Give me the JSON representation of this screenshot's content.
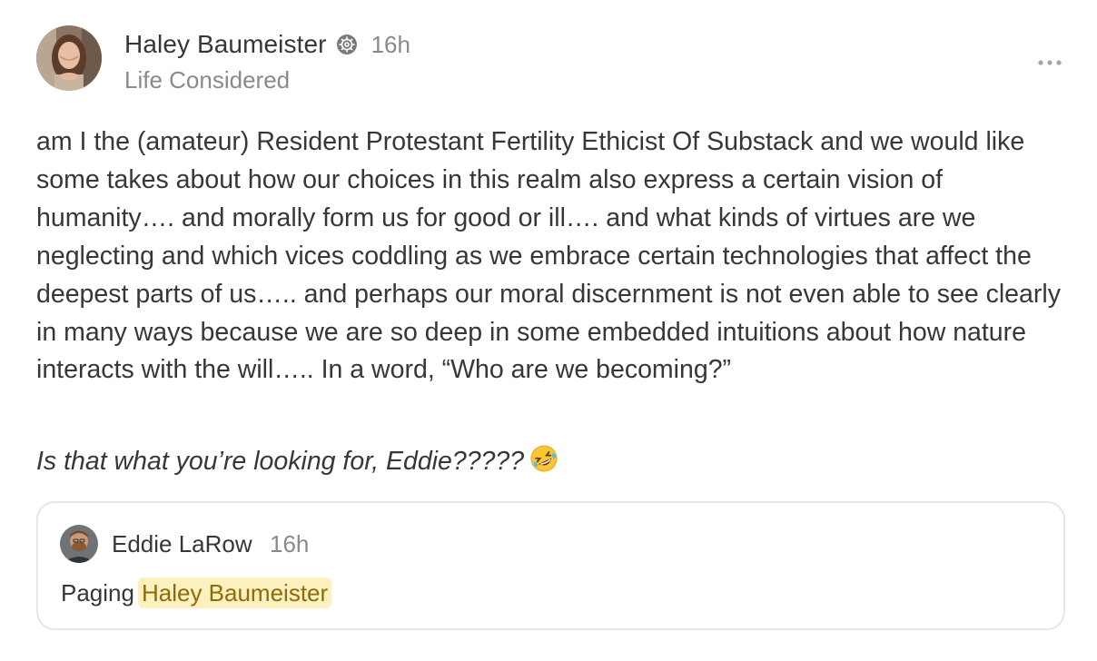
{
  "post": {
    "author": {
      "name": "Haley Baumeister",
      "publication": "Life Considered",
      "timestamp": "16h",
      "badge_icon": "substack-badge-icon"
    },
    "more_icon": "ellipsis-icon",
    "body": "am I the (amateur) Resident Protestant Fertility Ethicist Of Substack and we would like some takes about how our choices in this realm also express a certain vision of humanity…. and morally form us for good or ill…. and what kinds of virtues are we neglecting and which vices coddling as we embrace certain technologies that affect the deepest parts of us….. and perhaps our moral discernment is not even able to see clearly in many ways because we are so deep in some embedded intuitions about how nature interacts with the will….. In a word, “Who are we becoming?”",
    "italic_line": "Is that what you’re looking for, Eddie?????",
    "emoji": "🤣",
    "quoted": {
      "author": "Eddie LaRow",
      "timestamp": "16h",
      "text_prefix": "Paging",
      "mention": "Haley Baumeister"
    }
  },
  "colors": {
    "text": "#363737",
    "muted": "#8a8a8a",
    "mention_bg": "#fdf0bf",
    "mention_text": "#8a6d0a",
    "card_border": "#e6e6e6"
  }
}
